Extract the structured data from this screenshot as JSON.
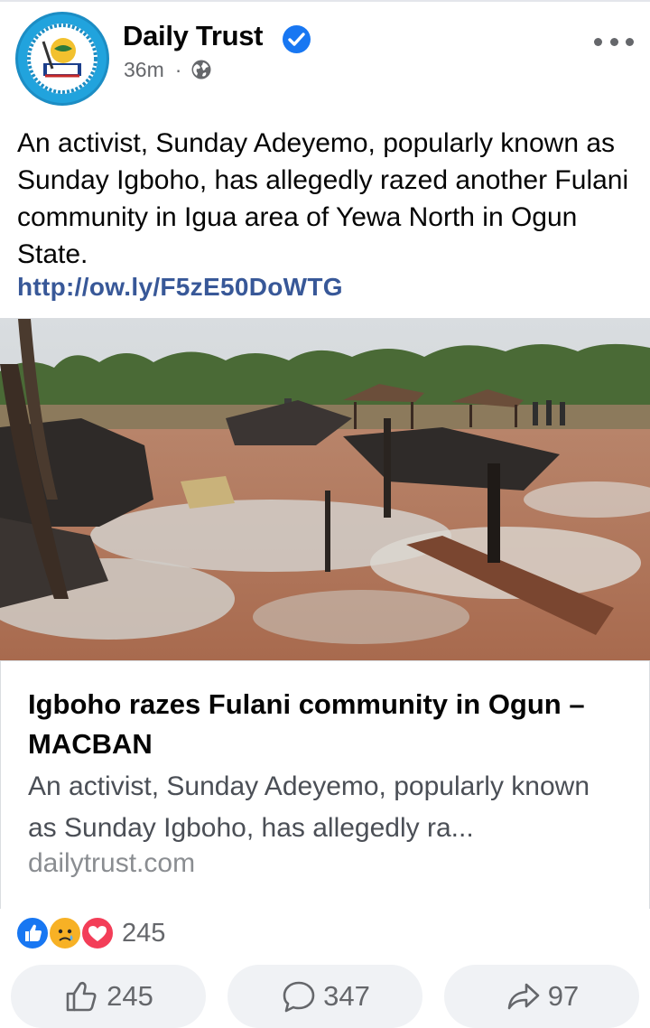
{
  "post": {
    "page_name": "Daily Trust",
    "time": "36m",
    "separator": "·",
    "privacy_icon": "globe-icon",
    "body": "An activist, Sunday Adeyemo, popularly known as Sunday Igboho, has allegedly razed another Fulani community in Igua area of Yewa North in Ogun State.",
    "link": "http://ow.ly/F5zE50DoWTG"
  },
  "link_card": {
    "title": "Igboho razes Fulani community in Ogun – MACBAN",
    "description": "An activist, Sunday Adeyemo, popularly known as Sunday Igboho, has allegedly ra...",
    "domain": "dailytrust.com"
  },
  "reactions": {
    "icons": [
      "like-reaction-icon",
      "sad-reaction-icon",
      "love-reaction-icon"
    ],
    "total": "245"
  },
  "actions": {
    "likes": "245",
    "comments": "347",
    "shares": "97"
  },
  "colors": {
    "facebook_blue": "#1877f2",
    "link_blue": "#385898",
    "secondary_text": "#65676b",
    "button_bg": "#f0f2f5"
  }
}
